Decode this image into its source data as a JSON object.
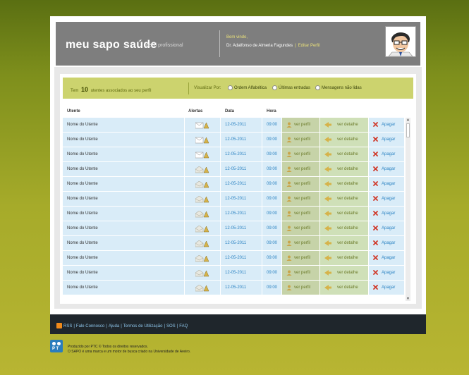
{
  "header": {
    "logo_text": "meu sapo saúde",
    "logo_subtitle": "perfil profissional",
    "welcome": "Bem vindo,",
    "doctor_name": "Dr. Adalfonso de Almeria Fagundes",
    "separator": "|",
    "edit_profile": "Editar Perfil"
  },
  "filter": {
    "count_prefix": "Tem",
    "count_value": "10",
    "count_suffix": "utentes associados ao seu perfil",
    "view_by": "Visualizar Por:",
    "options": [
      "Ordem Alfabética",
      "Últimas entradas",
      "Mensagens não lidas"
    ]
  },
  "table": {
    "headers": {
      "utente": "Utente",
      "alertas": "Alertas",
      "data": "Data",
      "hora": "Hora"
    },
    "rows": [
      {
        "name": "Nome do Utente",
        "alert": "message-warning",
        "date": "12-05-2011",
        "time": "09:00",
        "profile": "ver perfil",
        "detail": "ver detalhe",
        "delete": "Apagar"
      },
      {
        "name": "Nome do Utente",
        "alert": "message-warning",
        "date": "12-05-2011",
        "time": "09:00",
        "profile": "ver perfil",
        "detail": "ver detalhe",
        "delete": "Apagar"
      },
      {
        "name": "Nome do Utente",
        "alert": "message-warning",
        "date": "12-05-2011",
        "time": "09:00",
        "profile": "ver perfil",
        "detail": "ver detalhe",
        "delete": "Apagar"
      },
      {
        "name": "Nome do Utente",
        "alert": "read-warning",
        "date": "12-05-2011",
        "time": "09:00",
        "profile": "ver perfil",
        "detail": "ver detalhe",
        "delete": "Apagar"
      },
      {
        "name": "Nome do Utente",
        "alert": "read-warning",
        "date": "12-05-2011",
        "time": "09:00",
        "profile": "ver perfil",
        "detail": "ver detalhe",
        "delete": "Apagar"
      },
      {
        "name": "Nome do Utente",
        "alert": "read-warning",
        "date": "12-05-2011",
        "time": "09:00",
        "profile": "ver perfil",
        "detail": "ver detalhe",
        "delete": "Apagar"
      },
      {
        "name": "Nome do Utente",
        "alert": "read-warning",
        "date": "12-05-2011",
        "time": "09:00",
        "profile": "ver perfil",
        "detail": "ver detalhe",
        "delete": "Apagar"
      },
      {
        "name": "Nome do Utente",
        "alert": "read-warning",
        "date": "12-05-2011",
        "time": "09:00",
        "profile": "ver perfil",
        "detail": "ver detalhe",
        "delete": "Apagar"
      },
      {
        "name": "Nome do Utente",
        "alert": "read-warning",
        "date": "12-05-2011",
        "time": "09:00",
        "profile": "ver perfil",
        "detail": "ver detalhe",
        "delete": "Apagar"
      },
      {
        "name": "Nome do Utente",
        "alert": "read-warning",
        "date": "12-05-2011",
        "time": "09:00",
        "profile": "ver perfil",
        "detail": "ver detalhe",
        "delete": "Apagar"
      },
      {
        "name": "Nome do Utente",
        "alert": "read-warning",
        "date": "12-05-2011",
        "time": "09:00",
        "profile": "ver perfil",
        "detail": "ver detalhe",
        "delete": "Apagar"
      },
      {
        "name": "Nome do Utente",
        "alert": "read-warning",
        "date": "12-05-2011",
        "time": "09:00",
        "profile": "ver perfil",
        "detail": "ver detalhe",
        "delete": "Apagar"
      }
    ]
  },
  "footer": {
    "links": [
      "RSS",
      "Fale Connosco",
      "Ajuda",
      "Termos de Utilização",
      "SOS",
      "FAQ"
    ],
    "separator": "|",
    "credits_line1": "Produzido por PTC © Todos os direitos reservados.",
    "credits_line2": "O SAPO é uma marca e um motor de busca criado na Universidade de Aveiro.",
    "pt_logo_text": "P T"
  },
  "colors": {
    "accent_green": "#ccd36e",
    "header_gray": "#7e7e7e",
    "row_blue": "#d9ecf8",
    "link_blue": "#2a82c2",
    "delete_red": "#d03a2a"
  }
}
